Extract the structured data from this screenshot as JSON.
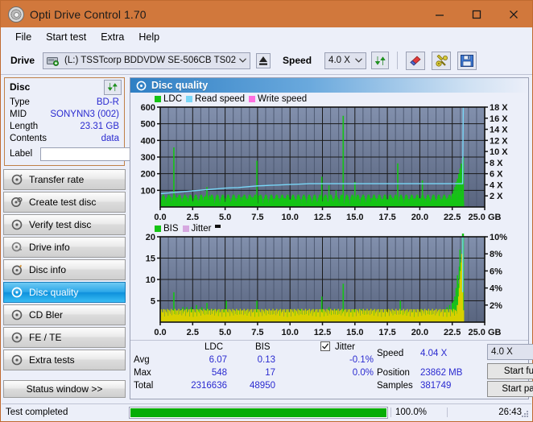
{
  "window": {
    "title": "Opti Drive Control 1.70",
    "icon": "disc-icon",
    "minimize": "minimize-button",
    "maximize": "maximize-button",
    "close": "close-button"
  },
  "menu": {
    "items": [
      "File",
      "Start test",
      "Extra",
      "Help"
    ]
  },
  "toolbar": {
    "drive_label": "Drive",
    "drive_value": "(L:)   TSSTcorp BDDVDW SE-506CB TS02",
    "eject_icon": "eject-icon",
    "speed_label": "Speed",
    "speed_value": "4.0 X",
    "refresh_icon": "refresh-icon",
    "erase_icon": "eraser-icon",
    "tools_icon": "pliers-icon",
    "save_icon": "save-floppy-icon"
  },
  "disc": {
    "title": "Disc",
    "refresh_icon": "refresh-icon",
    "rows": [
      {
        "key": "Type",
        "value": "BD-R"
      },
      {
        "key": "MID",
        "value": "SONYNN3 (002)"
      },
      {
        "key": "Length",
        "value": "23.31 GB"
      },
      {
        "key": "Contents",
        "value": "data"
      }
    ],
    "label_key": "Label",
    "label_value": "",
    "label_placeholder": "",
    "label_button_icon": "disc-icon"
  },
  "sidebar": {
    "items": [
      {
        "label": "Transfer rate",
        "icon": "disc-icon",
        "selected": false
      },
      {
        "label": "Create test disc",
        "icon": "disc-icon",
        "selected": false
      },
      {
        "label": "Verify test disc",
        "icon": "disc-icon",
        "selected": false
      },
      {
        "label": "Drive info",
        "icon": "disc-icon",
        "selected": false
      },
      {
        "label": "Disc info",
        "icon": "disc-icon",
        "selected": false
      },
      {
        "label": "Disc quality",
        "icon": "disc-icon",
        "selected": true
      },
      {
        "label": "CD Bler",
        "icon": "disc-icon",
        "selected": false
      },
      {
        "label": "FE / TE",
        "icon": "disc-icon",
        "selected": false
      },
      {
        "label": "Extra tests",
        "icon": "disc-icon",
        "selected": false
      }
    ],
    "status_window_button": "Status window >>"
  },
  "panel": {
    "title": "Disc quality",
    "icon": "disc-quality-icon"
  },
  "stats": {
    "col_ldc": "LDC",
    "col_bis": "BIS",
    "row_avg": "Avg",
    "row_max": "Max",
    "row_total": "Total",
    "ldc_avg": "6.07",
    "ldc_max": "548",
    "ldc_total": "2316636",
    "bis_avg": "0.13",
    "bis_max": "17",
    "bis_total": "48950",
    "jitter_label": "Jitter",
    "jitter_checked": true,
    "jitter_avg": "-0.1%",
    "jitter_max": "0.0%",
    "speed_label": "Speed",
    "speed_value": "4.04 X",
    "position_label": "Position",
    "position_value": "23862 MB",
    "samples_label": "Samples",
    "samples_value": "381749",
    "speed_select": "4.0 X",
    "start_full": "Start full",
    "start_part": "Start part"
  },
  "statusbar": {
    "message": "Test completed",
    "progress_pct": "100.0%",
    "progress_value": 100,
    "elapsed": "26:43"
  },
  "colors": {
    "titlebar": "#d1783c",
    "accent": "#2a2ad0",
    "ldc_green": "#15c415",
    "bis_green": "#15c415",
    "read_speed": "#79d6f7",
    "write_speed": "#ff6fe0",
    "jitter": "#d6a8e0",
    "jitter_bar": "#d8d000",
    "plot_bg_top": "#7e8aa8",
    "plot_bg_bottom": "#5c6884",
    "progress_green": "#07ad07"
  },
  "chart_data": [
    {
      "type": "line",
      "name": "disc-quality-ldc-chart",
      "title": "",
      "xlabel": "GB",
      "ylabel": "LDC",
      "xlim": [
        0,
        25
      ],
      "ylim": [
        0,
        600
      ],
      "y2lim": [
        0,
        18
      ],
      "y2label": "X",
      "xticks": [
        0.0,
        2.5,
        5.0,
        7.5,
        10.0,
        12.5,
        15.0,
        17.5,
        20.0,
        22.5,
        25.0
      ],
      "xticklabels": [
        "0.0",
        "2.5",
        "5.0",
        "7.5",
        "10.0",
        "12.5",
        "15.0",
        "17.5",
        "20.0",
        "22.5",
        "25.0 GB"
      ],
      "yticks": [
        100,
        200,
        300,
        400,
        500,
        600
      ],
      "y2ticks": [
        2,
        4,
        6,
        8,
        10,
        12,
        14,
        16,
        18
      ],
      "y2ticklabels": [
        "2 X",
        "4 X",
        "6 X",
        "8 X",
        "10 X",
        "12 X",
        "14 X",
        "16 X",
        "18 X"
      ],
      "grid": true,
      "legend": [
        {
          "label": "LDC",
          "color": "#15c415"
        },
        {
          "label": "Read speed",
          "color": "#79d6f7"
        },
        {
          "label": "Write speed",
          "color": "#ff6fe0"
        }
      ],
      "series": [
        {
          "name": "LDC",
          "color": "#15c415",
          "kind": "impulse",
          "x": [
            0.05,
            0.2,
            0.35,
            0.5,
            0.65,
            0.8,
            0.95,
            1.05,
            1.15,
            1.3,
            1.45,
            1.6,
            1.75,
            1.9,
            2.05,
            2.2,
            2.4,
            2.6,
            2.8,
            3.0,
            3.2,
            3.4,
            3.6,
            3.8,
            3.95,
            4.1,
            4.3,
            4.5,
            4.7,
            4.9,
            5.1,
            5.3,
            5.5,
            5.7,
            5.9,
            6.1,
            6.3,
            6.5,
            6.7,
            6.9,
            7.1,
            7.3,
            7.45,
            7.6,
            7.8,
            8.0,
            8.2,
            8.4,
            8.6,
            8.8,
            9.0,
            9.2,
            9.4,
            9.6,
            9.8,
            10.0,
            10.2,
            10.4,
            10.6,
            10.8,
            11.0,
            11.2,
            11.4,
            11.6,
            11.8,
            12.0,
            12.2,
            12.45,
            12.6,
            12.8,
            13.0,
            13.2,
            13.4,
            13.55,
            13.7,
            13.9,
            14.1,
            14.3,
            14.5,
            14.7,
            14.85,
            15.0,
            15.2,
            15.35,
            15.5,
            15.7,
            15.9,
            16.1,
            16.3,
            16.5,
            16.7,
            16.9,
            17.1,
            17.3,
            17.5,
            17.7,
            17.9,
            18.1,
            18.3,
            18.5,
            18.7,
            18.85,
            19.0,
            19.2,
            19.4,
            19.6,
            19.8,
            20.0,
            20.2,
            20.4,
            20.55,
            20.7,
            20.9,
            21.1,
            21.3,
            21.5,
            21.7,
            21.9,
            22.1,
            22.3,
            22.5,
            22.6,
            22.7,
            22.8,
            22.9,
            23.0,
            23.1,
            23.2,
            23.3,
            23.35
          ],
          "y": [
            30,
            45,
            40,
            55,
            48,
            60,
            52,
            358,
            70,
            58,
            50,
            45,
            55,
            48,
            60,
            50,
            44,
            52,
            40,
            48,
            55,
            62,
            120,
            70,
            50,
            45,
            55,
            48,
            50,
            44,
            52,
            48,
            40,
            45,
            52,
            48,
            60,
            55,
            50,
            46,
            58,
            50,
            278,
            68,
            54,
            48,
            50,
            45,
            52,
            48,
            44,
            50,
            46,
            52,
            48,
            44,
            50,
            46,
            52,
            48,
            44,
            50,
            46,
            52,
            48,
            44,
            50,
            182,
            60,
            46,
            130,
            52,
            48,
            100,
            50,
            46,
            548,
            54,
            48,
            50,
            60,
            150,
            52,
            48,
            56,
            50,
            44,
            48,
            52,
            46,
            50,
            54,
            48,
            52,
            46,
            50,
            54,
            48,
            262,
            56,
            50,
            46,
            52,
            48,
            44,
            50,
            46,
            52,
            160,
            48,
            54,
            50,
            46,
            52,
            48,
            44,
            50,
            46,
            52,
            60,
            80,
            100,
            120,
            150,
            170,
            200,
            230,
            260,
            285,
            300
          ]
        },
        {
          "name": "Read speed",
          "color": "#79d6f7",
          "kind": "line",
          "x": [
            0.0,
            0.5,
            1.0,
            1.5,
            2.0,
            2.5,
            3.0,
            3.5,
            4.0,
            4.5,
            5.0,
            5.5,
            6.0,
            6.5,
            7.0,
            7.5,
            8.0,
            8.5,
            9.0,
            9.5,
            10.0,
            10.5,
            11.0,
            11.5,
            12.0,
            14.0,
            16.0,
            18.0,
            20.0,
            22.0,
            23.2,
            23.3,
            23.35,
            23.4
          ],
          "y": [
            2.4,
            2.5,
            2.6,
            2.7,
            2.8,
            2.9,
            3.0,
            3.1,
            3.2,
            3.3,
            3.4,
            3.45,
            3.5,
            3.6,
            3.7,
            3.8,
            3.85,
            3.9,
            3.95,
            4.0,
            4.05,
            4.1,
            4.15,
            4.2,
            4.2,
            4.2,
            4.2,
            4.2,
            4.2,
            4.2,
            4.2,
            4.2,
            18.0,
            18.0
          ],
          "axis": "y2"
        }
      ]
    },
    {
      "type": "line",
      "name": "disc-quality-bis-chart",
      "title": "",
      "xlabel": "GB",
      "ylabel": "BIS",
      "xlim": [
        0,
        25
      ],
      "ylim": [
        0,
        20
      ],
      "y2lim": [
        0,
        10
      ],
      "y2label": "%",
      "xticks": [
        0.0,
        2.5,
        5.0,
        7.5,
        10.0,
        12.5,
        15.0,
        17.5,
        20.0,
        22.5,
        25.0
      ],
      "xticklabels": [
        "0.0",
        "2.5",
        "5.0",
        "7.5",
        "10.0",
        "12.5",
        "15.0",
        "17.5",
        "20.0",
        "22.5",
        "25.0 GB"
      ],
      "yticks": [
        5,
        10,
        15,
        20
      ],
      "y2ticks": [
        2,
        4,
        6,
        8,
        10
      ],
      "y2ticklabels": [
        "2%",
        "4%",
        "6%",
        "8%",
        "10%"
      ],
      "grid": true,
      "legend": [
        {
          "label": "BIS",
          "color": "#15c415"
        },
        {
          "label": "Jitter",
          "color": "#d6a8e0"
        }
      ],
      "series": [
        {
          "name": "BIS",
          "color": "#15c415",
          "kind": "impulse",
          "x": [
            0.05,
            0.2,
            0.35,
            0.5,
            0.65,
            0.8,
            0.95,
            1.05,
            1.15,
            1.3,
            1.45,
            1.6,
            1.75,
            1.9,
            2.05,
            2.2,
            2.4,
            2.6,
            2.8,
            3.0,
            3.2,
            3.4,
            3.6,
            3.8,
            3.95,
            4.1,
            4.3,
            4.5,
            4.7,
            4.9,
            5.1,
            5.3,
            5.5,
            5.7,
            5.9,
            6.1,
            6.3,
            6.5,
            6.7,
            6.9,
            7.1,
            7.3,
            7.45,
            7.6,
            7.8,
            8.0,
            8.2,
            8.4,
            8.6,
            8.8,
            9.0,
            9.2,
            9.4,
            9.6,
            9.8,
            10.0,
            10.2,
            10.4,
            10.6,
            10.8,
            11.0,
            11.2,
            11.4,
            11.6,
            11.8,
            12.0,
            12.2,
            12.45,
            12.6,
            12.8,
            13.0,
            13.2,
            13.4,
            13.55,
            13.7,
            13.9,
            14.1,
            14.3,
            14.5,
            14.7,
            14.85,
            15.0,
            15.2,
            15.35,
            15.5,
            15.7,
            15.9,
            16.1,
            16.3,
            16.5,
            16.7,
            16.9,
            17.1,
            17.3,
            17.5,
            17.7,
            17.9,
            18.1,
            18.3,
            18.5,
            18.7,
            18.85,
            19.0,
            19.2,
            19.4,
            19.6,
            19.8,
            20.0,
            20.2,
            20.4,
            20.55,
            20.7,
            20.9,
            21.1,
            21.3,
            21.5,
            21.7,
            21.9,
            22.1,
            22.3,
            22.5,
            22.6,
            22.7,
            22.8,
            22.9,
            23.0,
            23.05,
            23.1,
            23.15,
            23.2,
            23.25,
            23.3,
            23.35
          ],
          "y": [
            2,
            2,
            1.5,
            2,
            1.5,
            2,
            1.5,
            7,
            2.5,
            2,
            2.5,
            3,
            3.5,
            3,
            3.5,
            3,
            3.5,
            3,
            4,
            3,
            3.5,
            3,
            4.5,
            3,
            2.5,
            3,
            2.5,
            3,
            2.5,
            3,
            5,
            2.5,
            2,
            2.5,
            3,
            2.5,
            2,
            2.5,
            2,
            2.5,
            2,
            2.5,
            5,
            2.5,
            2,
            2.5,
            2,
            2.5,
            2,
            2.5,
            2,
            2.5,
            2,
            2.5,
            2,
            2.5,
            2,
            2.5,
            2,
            3,
            2,
            2.5,
            2,
            2.5,
            2,
            2.5,
            2,
            6,
            2.5,
            2,
            3.5,
            2.5,
            2,
            3,
            2.5,
            2,
            9,
            2.5,
            2,
            2.5,
            3,
            3,
            2.5,
            2,
            3,
            2.5,
            2,
            2.5,
            2,
            2.5,
            2,
            2.5,
            2,
            2.5,
            2,
            2.5,
            2,
            2.5,
            2,
            5,
            2.5,
            2,
            2.5,
            2,
            2.5,
            2,
            2.5,
            2,
            3,
            2.5,
            2,
            2.5,
            2,
            2.5,
            2,
            2.5,
            2,
            3,
            3.5,
            4,
            4.5,
            5,
            6,
            8,
            11,
            9,
            13,
            17,
            14,
            9,
            3
          ]
        },
        {
          "name": "Jitter",
          "color": "#d8d000",
          "kind": "impulse",
          "x": [
            22.9,
            23.0,
            23.05,
            23.1,
            23.15,
            23.2,
            23.25,
            23.3
          ],
          "y": [
            4,
            6,
            8,
            10,
            12,
            14,
            16,
            14
          ]
        },
        {
          "name": "Read speed",
          "color": "#79d6f7",
          "kind": "line",
          "x": [
            23.3,
            23.32,
            23.35
          ],
          "y": [
            7,
            20,
            20
          ]
        }
      ]
    }
  ]
}
